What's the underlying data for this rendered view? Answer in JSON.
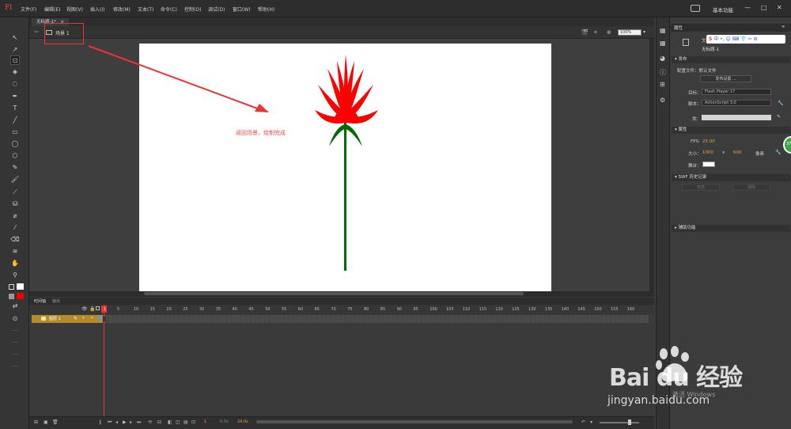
{
  "app": {
    "logo": "Fl",
    "menus": [
      "文件(F)",
      "编辑(E)",
      "视图(V)",
      "插入(I)",
      "修改(M)",
      "文本(T)",
      "命令(C)",
      "控制(O)",
      "调试(D)",
      "窗口(W)",
      "帮助(H)"
    ],
    "workspace": "基本功能",
    "win_controls": [
      "—",
      "□",
      "✕"
    ]
  },
  "document": {
    "tab_name": "无标题-1*",
    "tab_close": "×",
    "scene": "场景 1",
    "zoom": "100%",
    "annotation": "返回场景，绘制完成"
  },
  "timeline": {
    "tabs": [
      "时间轴",
      "输出"
    ],
    "layer_name": "图层 1",
    "ticks": [
      "1",
      "5",
      "10",
      "15",
      "20",
      "25",
      "30",
      "35",
      "40",
      "45",
      "50",
      "55",
      "60",
      "65",
      "70",
      "75",
      "80",
      "85",
      "90",
      "95",
      "100",
      "105",
      "110",
      "115",
      "120",
      "125",
      "130",
      "135",
      "140",
      "145",
      "150",
      "155",
      "160"
    ],
    "current_frame": "1",
    "time": "0.0s",
    "fps": "24.0s"
  },
  "properties": {
    "tab": "属性",
    "doc_type": "文档",
    "doc_name": "无标题-1",
    "publish": {
      "header": "发布",
      "profile_label": "配置文件：",
      "profile_value": "默认文件",
      "settings_button": "发布设置 ...",
      "target_label": "目标：",
      "target_value": "Flash Player 17",
      "script_label": "脚本：",
      "script_value": "ActionScript 3.0",
      "class_label": "类："
    },
    "attributes": {
      "header": "属性",
      "fps_label": "FPS:",
      "fps_value": "25.00",
      "size_label": "大小：",
      "width": "1000",
      "x": "x",
      "height": "600",
      "px": "像素",
      "stage_label": "舞台："
    },
    "swf_history": {
      "header": "SWF 历史记录",
      "log_button": "日志",
      "clear_button": "清除"
    },
    "accessibility": {
      "header": "辅助功能"
    }
  },
  "overlay": {
    "ime": "中 •, ☺ ⌨ 👕 ✂ ⚙",
    "ime_logo": "S",
    "float_badge": "37",
    "activate_windows": "激活 Windows",
    "watermark_brand": "Bai du 经验",
    "watermark_url": "jingyan.baidu.com"
  },
  "colors": {
    "flower_red": "#ff0000",
    "stem_green": "#006b00",
    "annotation_red": "#e84a4a",
    "layer_gold": "#b58a2a"
  }
}
